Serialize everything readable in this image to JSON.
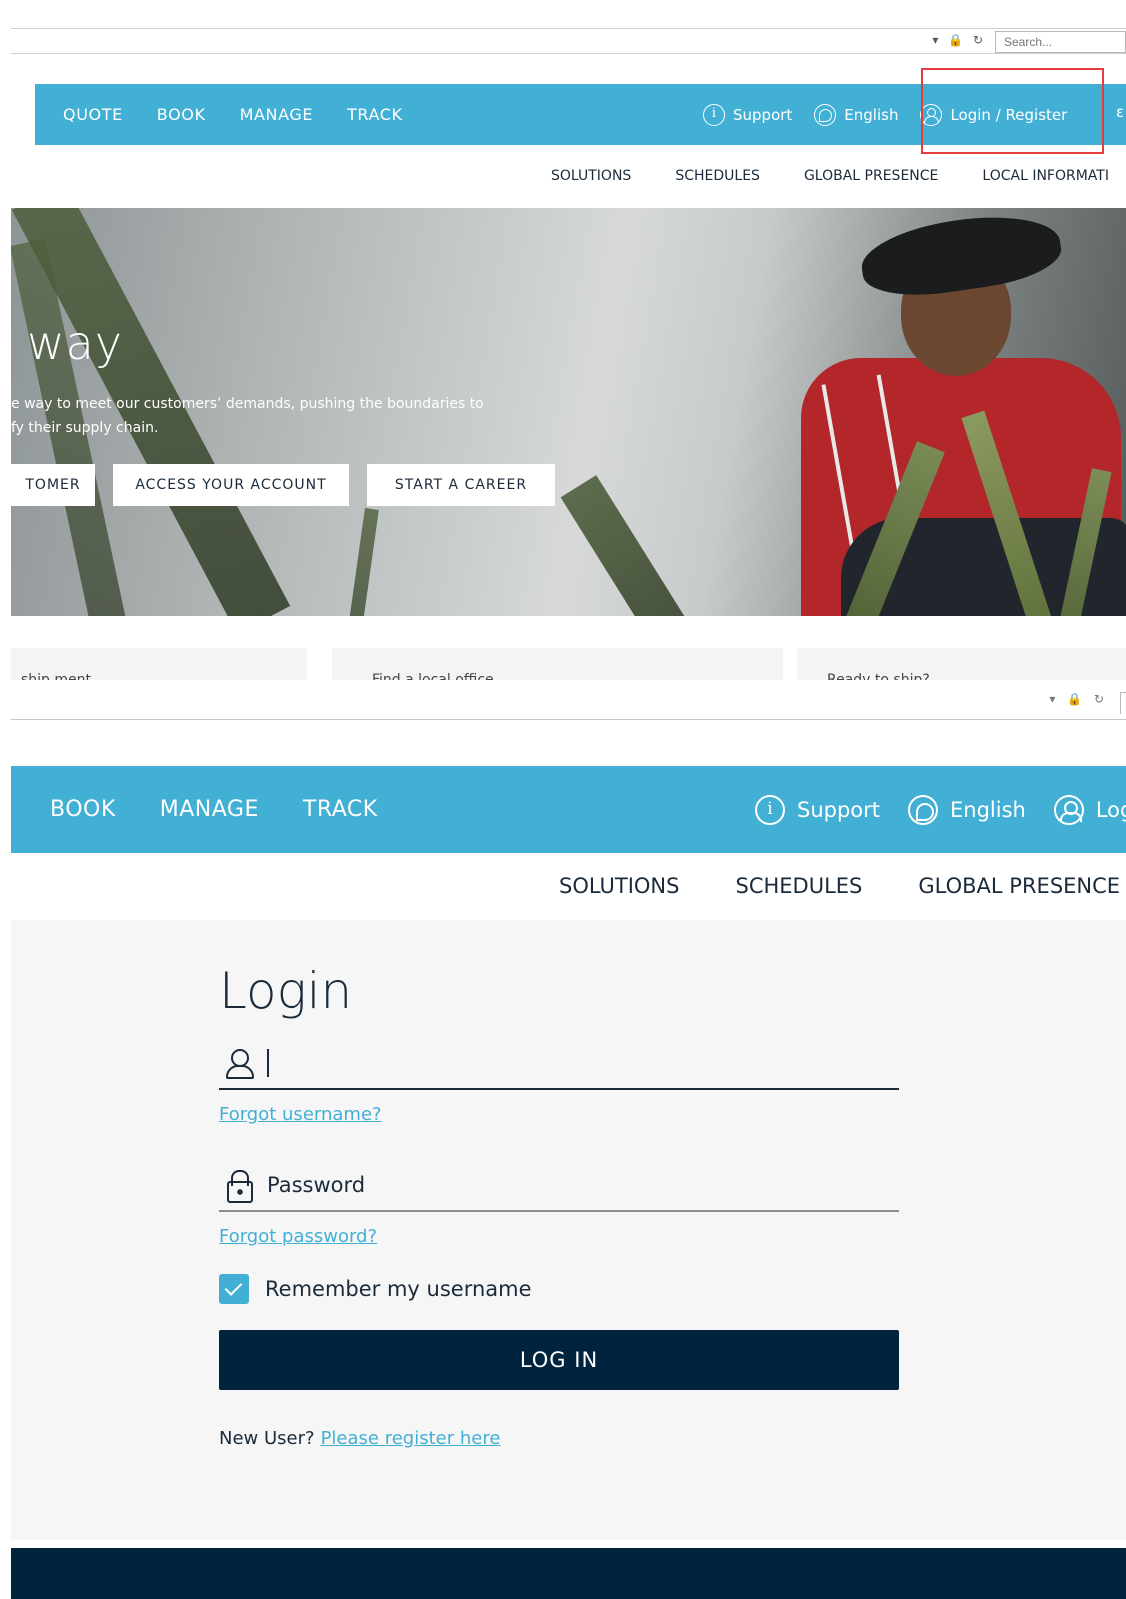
{
  "top": {
    "browser": {
      "icons": "▾ 🔒 ↻",
      "search_placeholder": "Search..."
    },
    "primary_nav": [
      "QUOTE",
      "BOOK",
      "MANAGE",
      "TRACK"
    ],
    "utility": {
      "support": "Support",
      "language": "English",
      "login": "Login / Register"
    },
    "secondary_nav": [
      "SOLUTIONS",
      "SCHEDULES",
      "GLOBAL PRESENCE",
      "LOCAL INFORMATI"
    ],
    "hero": {
      "title": "way",
      "description_line1": "e way to meet our customers’ demands, pushing the boundaries to",
      "description_line2": "fy their supply chain.",
      "buttons": [
        "TOMER",
        "ACCESS YOUR ACCOUNT",
        "START A CAREER"
      ]
    },
    "cards": [
      "ship ment",
      "Find a local office",
      "Ready to ship?"
    ]
  },
  "bottom": {
    "primary_nav": [
      "BOOK",
      "MANAGE",
      "TRACK"
    ],
    "utility": {
      "support": "Support",
      "language": "English",
      "login": "Log"
    },
    "secondary_nav": [
      "SOLUTIONS",
      "SCHEDULES",
      "GLOBAL PRESENCE"
    ],
    "login": {
      "title": "Login",
      "username_value": "",
      "forgot_username": "Forgot username?",
      "password_placeholder": "Password",
      "forgot_password": "Forgot password?",
      "remember_label": "Remember my username",
      "remember_checked": true,
      "login_button": "LOG IN",
      "new_user_text": "New User?",
      "register_link": "Please register here"
    }
  },
  "colors": {
    "accent": "#42b0d5",
    "navy": "#00243d",
    "highlight": "#e53d3d",
    "panel": "#f6f6f6"
  }
}
